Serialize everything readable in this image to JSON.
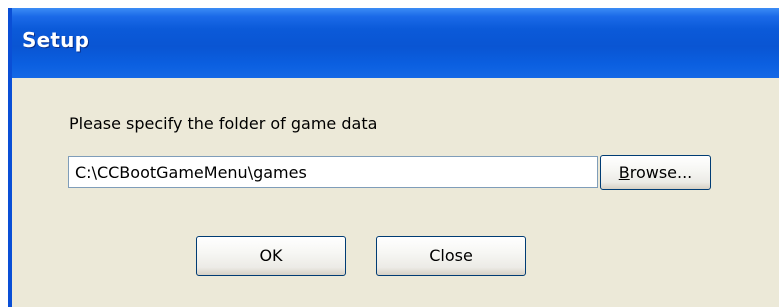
{
  "window": {
    "title": "Setup"
  },
  "dialog": {
    "prompt": "Please specify the folder of game data",
    "folder_path": "C:\\CCBootGameMenu\\games",
    "browse": {
      "mnemonic": "B",
      "rest": "rowse..."
    },
    "ok_label": "OK",
    "close_label": "Close"
  },
  "colors": {
    "titlebar": "#0a55d3",
    "dialog_background": "#ece9d8",
    "button_border": "#003c74",
    "input_border": "#7f9db9"
  }
}
